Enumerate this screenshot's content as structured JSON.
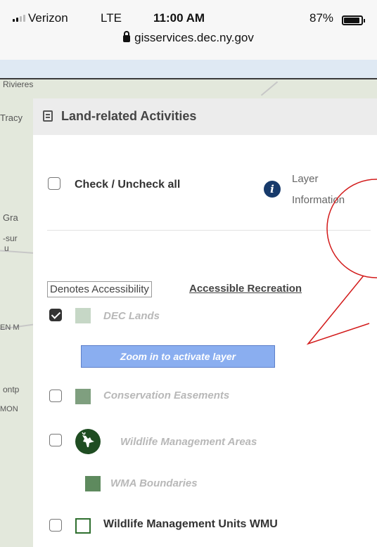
{
  "status_bar": {
    "carrier": "Verizon",
    "network": "LTE",
    "time": "11:00 AM",
    "battery": "87%"
  },
  "browser": {
    "url": "gisservices.dec.ny.gov"
  },
  "map": {
    "labels": [
      "Rivieres",
      "Tracy",
      "Gra",
      "-sur",
      "u",
      "EN M",
      "ontp",
      "MON"
    ]
  },
  "panel": {
    "title": "Land-related Activities",
    "check_all_label": "Check / Uncheck all",
    "layer_info_label": "Layer Information",
    "denotes_label": "Denotes Accessibility",
    "accessible_recreation": "Accessible Recreation",
    "layers": [
      {
        "label": "DEC Lands",
        "checked": true,
        "swatch_color": "#c6d7c6"
      },
      {
        "label": "Conservation Easements",
        "checked": false,
        "swatch_color": "#7f9f7f"
      },
      {
        "label": "Wildlife Management Areas",
        "checked": false,
        "icon": "deer-icon"
      },
      {
        "label": "WMA Boundaries",
        "swatch_color": "#5e8a5e"
      },
      {
        "label": "Wildlife Management Units WMU",
        "checked": false,
        "swatch_color": "#ffffff",
        "swatch_border": "#2f6f2f"
      }
    ],
    "zoom_button_label": "Zoom in to activate layer"
  },
  "colors": {
    "info_icon": "#173a6b",
    "zoom_button": "#8aaef0",
    "callout": "#d21a1a"
  }
}
